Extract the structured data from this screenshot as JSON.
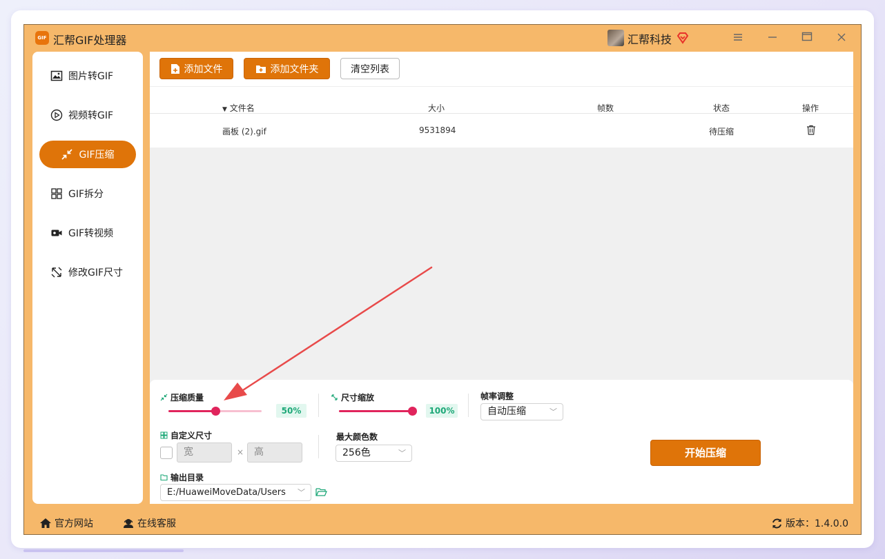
{
  "app": {
    "title": "汇帮GIF处理器",
    "logo_text": "GIF",
    "company": "汇帮科技"
  },
  "sidebar": {
    "items": [
      {
        "label": "图片转GIF",
        "icon": "image-icon",
        "active": false
      },
      {
        "label": "视频转GIF",
        "icon": "play-icon",
        "active": false
      },
      {
        "label": "GIF压缩",
        "icon": "compress-icon",
        "active": true
      },
      {
        "label": "GIF拆分",
        "icon": "split-icon",
        "active": false
      },
      {
        "label": "GIF转视频",
        "icon": "video-icon",
        "active": false
      },
      {
        "label": "修改GIF尺寸",
        "icon": "resize-icon",
        "active": false
      }
    ]
  },
  "toolbar": {
    "add_file": "添加文件",
    "add_folder": "添加文件夹",
    "clear_list": "清空列表"
  },
  "table": {
    "columns": [
      "文件名",
      "大小",
      "帧数",
      "状态",
      "操作"
    ],
    "rows": [
      {
        "name": "画板 (2).gif",
        "size": "9531894",
        "frames": "",
        "status": "待压缩"
      }
    ]
  },
  "settings": {
    "quality_label": "压缩质量",
    "quality_value": "50%",
    "quality_fraction": 0.5,
    "scale_label": "尺寸缩放",
    "scale_value": "100%",
    "scale_fraction": 1.0,
    "fps_label": "帧率调整",
    "fps_value": "自动压缩",
    "custom_size_label": "自定义尺寸",
    "width_placeholder": "宽",
    "height_placeholder": "高",
    "times": "×",
    "max_colors_label": "最大颜色数",
    "max_colors_value": "256色",
    "output_label": "输出目录",
    "output_value": "E:/HuaweiMoveData/Users",
    "start_button": "开始压缩"
  },
  "footer": {
    "website": "官方网站",
    "support": "在线客服",
    "version": "版本：1.4.0.0"
  },
  "colors": {
    "accent": "#df7409",
    "window_bg": "#f6b86a",
    "slider": "#e0245c",
    "badge_text": "#1ea878",
    "annotation": "#e84a4a"
  }
}
